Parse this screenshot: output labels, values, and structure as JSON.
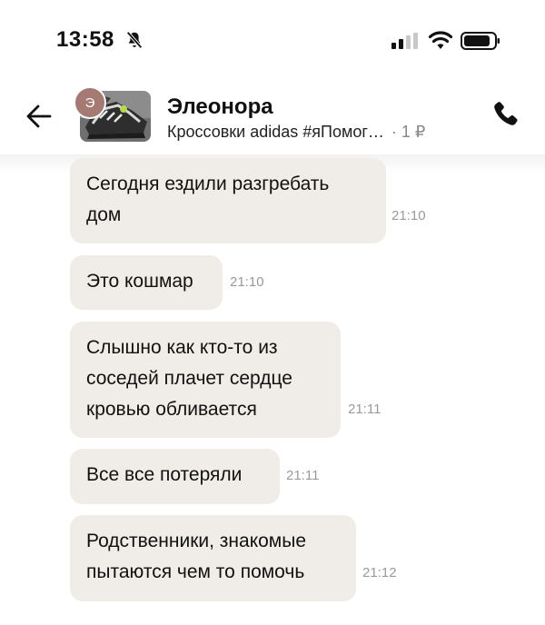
{
  "status_bar": {
    "time": "13:58"
  },
  "header": {
    "contact_name": "Элеонора",
    "avatar_letter": "Э",
    "listing_title": "Кроссовки adidas #яПомог…",
    "price": "· 1 ₽"
  },
  "messages": [
    {
      "text_lines": [
        "Сегодня ездили разгребать",
        "дом"
      ],
      "time": "21:10"
    },
    {
      "text_lines": [
        "Это кошмар"
      ],
      "time": "21:10"
    },
    {
      "text_lines": [
        "Слышно как кто-то из",
        "соседей плачет сердце",
        "кровью обливается"
      ],
      "time": "21:11"
    },
    {
      "text_lines": [
        "Все все потеряли"
      ],
      "time": "21:11"
    },
    {
      "text_lines": [
        "Родственники, знакомые",
        "пытаются чем то помочь"
      ],
      "time": "21:12"
    }
  ],
  "colors": {
    "bubble": "#f0ede8",
    "avatar": "#a47a72",
    "time": "#9a9a9a"
  },
  "icons": [
    "bell-slash-icon",
    "signal-icon",
    "wifi-icon",
    "battery-icon",
    "back-arrow-icon",
    "phone-icon"
  ]
}
